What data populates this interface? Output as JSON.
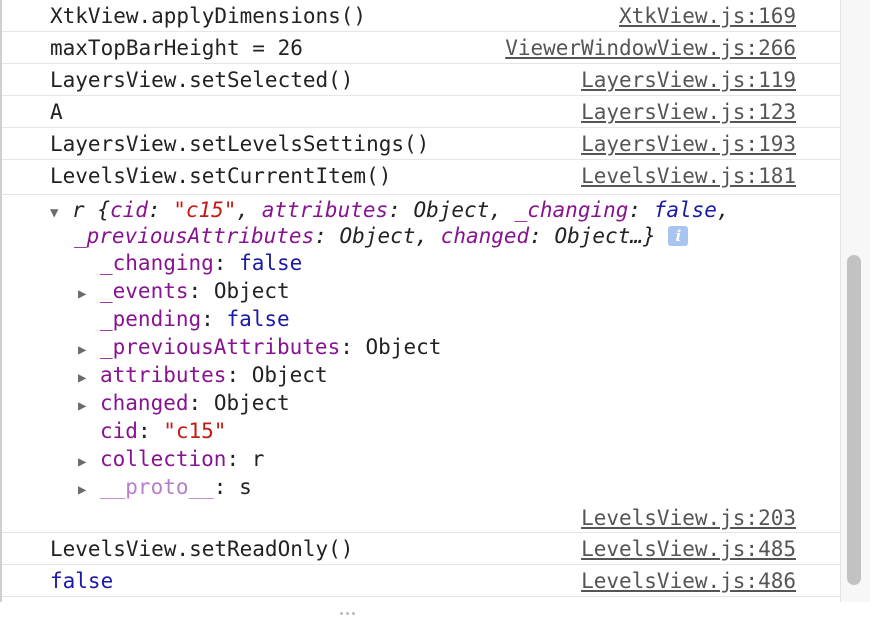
{
  "logs": [
    {
      "msg": "XtkView.applyDimensions()",
      "src": "XtkView.js:169"
    },
    {
      "msg": "maxTopBarHeight = 26",
      "src": "ViewerWindowView.js:266"
    },
    {
      "msg": "LayersView.setSelected()",
      "src": "LayersView.js:119"
    },
    {
      "msg": "A",
      "src": "LayersView.js:123"
    },
    {
      "msg": "LayersView.setLevelsSettings()",
      "src": "LayersView.js:193"
    },
    {
      "msg": "LevelsView.setCurrentItem()",
      "src": "LevelsView.js:181"
    }
  ],
  "object": {
    "summary": {
      "name": "r",
      "open": "{",
      "cid_key": "cid",
      "cid_val": "\"c15\"",
      "attributes_key": "attributes",
      "attributes_val": "Object",
      "changing_key": "_changing",
      "changing_val": "false",
      "previous_key": "_previousAttributes",
      "previous_val": "Object",
      "changed_key": "changed",
      "changed_val": "Object…}",
      "info": "i"
    },
    "props": {
      "changing": {
        "key": "_changing",
        "val": "false"
      },
      "events": {
        "key": "_events",
        "val": "Object"
      },
      "pending": {
        "key": "_pending",
        "val": "false"
      },
      "previous": {
        "key": "_previousAttributes",
        "val": "Object"
      },
      "attributes": {
        "key": "attributes",
        "val": "Object"
      },
      "changed": {
        "key": "changed",
        "val": "Object"
      },
      "cid": {
        "key": "cid",
        "val": "\"c15\""
      },
      "collection": {
        "key": "collection",
        "val": "r"
      },
      "proto": {
        "key": "__proto__",
        "val": "s"
      }
    },
    "src": "LevelsView.js:203"
  },
  "logs_after": [
    {
      "msg": "LevelsView.setReadOnly()",
      "src": "LevelsView.js:485"
    },
    {
      "msg": "false",
      "src": "LevelsView.js:486"
    }
  ],
  "colors": {
    "keyword": "#1a1aa6",
    "string": "#c41a16",
    "property": "#881391",
    "link": "#555555"
  },
  "icons": {
    "expanded": "triangle-down-icon",
    "collapsed": "triangle-right-icon",
    "info": "info-icon"
  }
}
